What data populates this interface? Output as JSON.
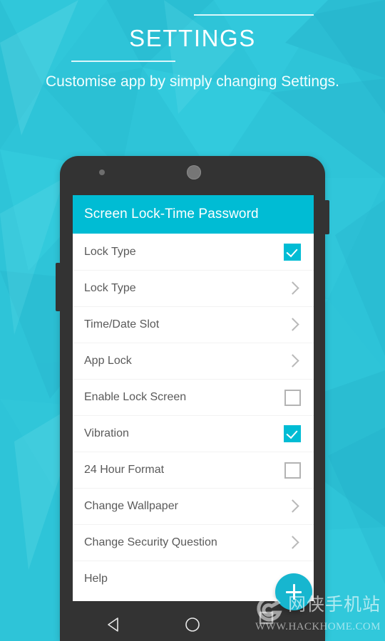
{
  "hero": {
    "title": "SETTINGS",
    "subtitle": "Customise app by simply changing Settings.",
    "accent_color": "#00bcd4",
    "background_color": "#2ec4d8"
  },
  "phone": {
    "frame_color": "#333333"
  },
  "app": {
    "appbar": {
      "title": "Screen Lock-Time Password",
      "background_color": "#00bcd4"
    },
    "list": [
      {
        "label": "Lock Type",
        "control": "checkbox-checked"
      },
      {
        "label": "Lock Type",
        "control": "chevron"
      },
      {
        "label": "Time/Date Slot",
        "control": "chevron"
      },
      {
        "label": "App Lock",
        "control": "chevron"
      },
      {
        "label": "Enable Lock Screen",
        "control": "checkbox-unchecked"
      },
      {
        "label": "Vibration",
        "control": "checkbox-checked"
      },
      {
        "label": "24 Hour Format",
        "control": "checkbox-unchecked"
      },
      {
        "label": "Change Wallpaper",
        "control": "chevron"
      },
      {
        "label": "Change Security Question",
        "control": "chevron"
      },
      {
        "label": "Help",
        "control": "none"
      }
    ],
    "fab": {
      "label": "+",
      "color": "#17b6cf"
    }
  },
  "navbar": {
    "back_label": "Back",
    "home_label": "Home"
  },
  "watermark": {
    "site_name_cn": "网侠手机站",
    "site_url": "WWW.HACKHOME.COM"
  }
}
